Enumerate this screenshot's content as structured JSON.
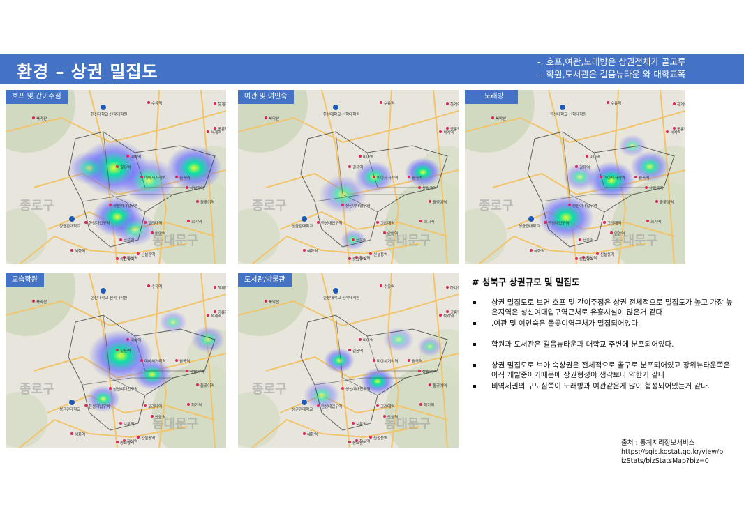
{
  "header": {
    "title": "환경 – 상권 밀집도",
    "notes": [
      "-. 호프,여관,노래방은 상권전체가 골고루",
      "-. 학원,도서관은 길음뉴타운 와 대학교쪽"
    ]
  },
  "panels": [
    {
      "label": "호프 및 간이주점"
    },
    {
      "label": "여관 및 여인숙"
    },
    {
      "label": "노래방"
    },
    {
      "label": "교습학원"
    },
    {
      "label": "도서관/박물관"
    }
  ],
  "map_labels": {
    "district_left": "종로구",
    "district_right": "동대문구",
    "university": "한신대학교 신학대학원",
    "campus": "성균관대학교",
    "stations": [
      "수유역",
      "미아역",
      "미아사거리역",
      "길음역",
      "성신여대입구역",
      "한성대입구역",
      "혜화역",
      "보문역",
      "월곡역",
      "고려대역",
      "안암역",
      "상월곡역",
      "돌곶이역",
      "석계역",
      "창신역",
      "동묘앞역",
      "신설동역",
      "북악산",
      "하계역",
      "공릉역",
      "회기역"
    ],
    "roads": [
      "북부간선도로",
      "내부순환로"
    ]
  },
  "summary": {
    "title": "# 성북구 상권규모 및 밀집도",
    "bullets": [
      "상권 밀집도로 보면 호프 및 간이주점은 상권 전체적으로 밀집도가 높고 가장 높은지역은  성신여대입구역근처로  유흥시설이 많은거 같다",
      ".여관 및 여인숙은 돌곶이역근처가 밀집되어있다.",
      "학원과 도서관은 길음뉴타운과 대학교 주변에 분포되어있다.",
      "상권 밀집도로 보아 숙상권은 전체적으로 골구로 분포되어있고 장위뉴타운쪽은 아직 개발중이기때문에  상권형성이 생각보다 약한거 같다",
      "비역세권의 구도심쪽이   노래방과 여관같은게   많이 형성되어있는거 같다."
    ]
  },
  "source": {
    "label": "출처 : 통계지리정보서비스",
    "url_line1": "https://sgis.kostat.go.kr/view/b",
    "url_line2": "izStats/bizStatsMap?biz=0"
  },
  "colors": {
    "accent": "#4472c4",
    "heat_low": "#6a6cff",
    "heat_mid": "#00e0a0",
    "heat_high": "#e8ff30"
  }
}
